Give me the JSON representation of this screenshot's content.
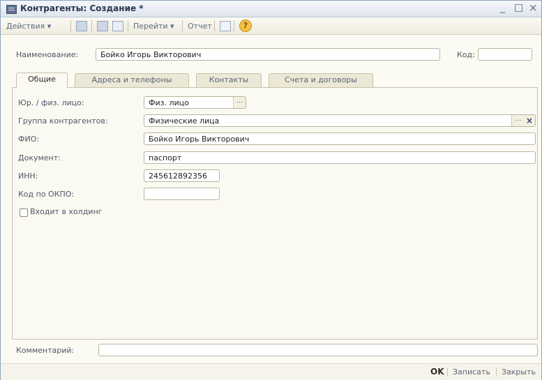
{
  "window": {
    "title": "Контрагенты: Создание *",
    "controls": {
      "minimize": "_",
      "maximize": "□",
      "close": "×"
    }
  },
  "toolbar": {
    "actions": "Действия ▾",
    "goto": "Перейти ▾",
    "report": "Отчет",
    "help": "?"
  },
  "header": {
    "name_label": "Наименование:",
    "name_value": "Бойко Игорь Викторович",
    "code_label": "Код:",
    "code_value": ""
  },
  "tabs": [
    {
      "label": "Общие",
      "active": true
    },
    {
      "label": "Адреса и телефоны",
      "active": false
    },
    {
      "label": "Контакты",
      "active": false
    },
    {
      "label": "Счета и договоры",
      "active": false
    }
  ],
  "general": {
    "entity_type_label": "Юр. / физ. лицо:",
    "entity_type_value": "Физ. лицо",
    "group_label": "Группа контрагентов:",
    "group_value": "Физические лица",
    "fio_label": "ФИО:",
    "fio_value": "Бойко Игорь Викторович",
    "document_label": "Документ:",
    "document_value": "паспорт",
    "inn_label": "ИНН:",
    "inn_value": "245612892356",
    "okpo_label": "Код по ОКПО:",
    "okpo_value": "",
    "holding_label": "Входит в холдинг",
    "holding_checked": false,
    "select_button": "...",
    "clear_button": "×"
  },
  "comment": {
    "label": "Комментарий:",
    "value": ""
  },
  "footer": {
    "ok": "OK",
    "save": "Записать",
    "close": "Закрыть"
  },
  "colors": {
    "accent": "#2a3550",
    "background": "#fbfaf2",
    "help_icon": "#f2c24a"
  }
}
